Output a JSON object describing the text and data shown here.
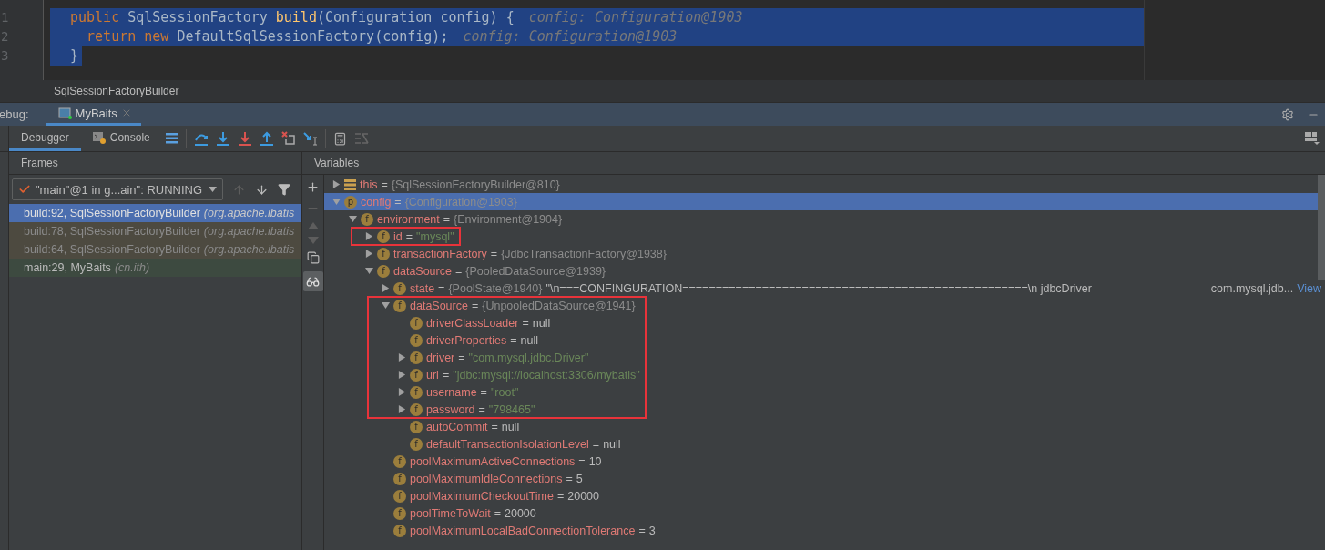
{
  "editor": {
    "line_numbers": [
      "1",
      "2",
      "3"
    ],
    "lines": [
      {
        "kind": "full",
        "selected": true,
        "tokens": [
          {
            "kind": "keyword",
            "text": "public"
          },
          {
            "kind": "plain",
            "text": " SqlSessionFactory "
          },
          {
            "kind": "method",
            "text": "build"
          },
          {
            "kind": "plain",
            "text": "(Configuration config) {"
          }
        ],
        "hint": "config: Configuration@1903"
      },
      {
        "kind": "full",
        "selected": true,
        "tokens": [
          {
            "kind": "keyword",
            "text": "  return new"
          },
          {
            "kind": "plain",
            "text": " DefaultSqlSessionFactory(config);"
          }
        ],
        "hint": "config: Configuration@1903"
      },
      {
        "kind": "partial",
        "selected": true,
        "tokens": [
          {
            "kind": "plain",
            "text": "}"
          }
        ]
      }
    ]
  },
  "breadcrumb": "SqlSessionFactoryBuilder",
  "debug_bar": {
    "label": "ebug:",
    "tabs": [
      {
        "label": "MyBaits",
        "selected": true
      }
    ]
  },
  "toolbar": {
    "tabs": [
      {
        "label": "Debugger",
        "selected": true,
        "kind": "plain"
      },
      {
        "label": "Console",
        "selected": false,
        "kind": "console"
      }
    ]
  },
  "frames": {
    "title": "Frames",
    "thread": "\"main\"@1 in g...ain\": RUNNING",
    "items": [
      {
        "method": "build:92, SqlSessionFactoryBuilder",
        "package": "(org.apache.ibatis",
        "kind": "library",
        "selected": true
      },
      {
        "method": "build:78, SqlSessionFactoryBuilder",
        "package": "(org.apache.ibatis",
        "kind": "library",
        "selected": false
      },
      {
        "method": "build:64, SqlSessionFactoryBuilder",
        "package": "(org.apache.ibatis",
        "kind": "library",
        "selected": false
      },
      {
        "method": "main:29, MyBaits",
        "package": "(cn.ith)",
        "kind": "project",
        "selected": false
      }
    ]
  },
  "variables": {
    "title": "Variables",
    "tree": [
      {
        "kind": "list",
        "name": "this",
        "equals": "=",
        "object_ref": "{SqlSessionFactoryBuilder@810}",
        "expanded": false,
        "selected": false,
        "highlight": false
      },
      {
        "kind": "member",
        "badge": "p",
        "name": "config",
        "equals": "=",
        "object_ref": "{Configuration@1903}",
        "expanded": true,
        "selected": true,
        "highlight": false,
        "children": [
          {
            "kind": "member",
            "badge": "f",
            "name": "environment",
            "equals": "=",
            "object_ref": "{Environment@1904}",
            "expanded": true,
            "selected": false,
            "highlight": false,
            "children": [
              {
                "kind": "member",
                "badge": "f",
                "name": "id",
                "equals": "=",
                "string_value": "\"mysql\"",
                "expanded": false,
                "selected": false,
                "highlight": true
              },
              {
                "kind": "member",
                "badge": "f",
                "name": "transactionFactory",
                "equals": "=",
                "object_ref": "{JdbcTransactionFactory@1938}",
                "expanded": false,
                "selected": false,
                "highlight": false
              },
              {
                "kind": "member",
                "badge": "f",
                "name": "dataSource",
                "equals": "=",
                "object_ref": "{PooledDataSource@1939}",
                "expanded": true,
                "selected": false,
                "highlight": false,
                "children": [
                  {
                    "kind": "member",
                    "badge": "f",
                    "name": "state",
                    "equals": "=",
                    "object_ref": "{PoolState@1940}",
                    "preview": "\"\\n===CONFINGURATION====================================================\\n jdbcDriver",
                    "preview_tail": "com.mysql.jdb...",
                    "link": "View",
                    "expanded": false,
                    "selected": false,
                    "highlight": false
                  },
                  {
                    "kind": "member",
                    "badge": "f",
                    "name": "dataSource",
                    "equals": "=",
                    "object_ref": "{UnpooledDataSource@1941}",
                    "expanded": true,
                    "selected": false,
                    "highlight": true,
                    "children": [
                      {
                        "kind": "member",
                        "badge": "f",
                        "name": "driverClassLoader",
                        "equals": "=",
                        "value": "null",
                        "selected": false,
                        "highlight": true
                      },
                      {
                        "kind": "member",
                        "badge": "f",
                        "name": "driverProperties",
                        "equals": "=",
                        "value": "null",
                        "selected": false,
                        "highlight": true
                      },
                      {
                        "kind": "member",
                        "badge": "f",
                        "name": "driver",
                        "equals": "=",
                        "string_value": "\"com.mysql.jdbc.Driver\"",
                        "expanded": false,
                        "selected": false,
                        "highlight": true
                      },
                      {
                        "kind": "member",
                        "badge": "f",
                        "name": "url",
                        "equals": "=",
                        "string_value": "\"jdbc:mysql://localhost:3306/mybatis\"",
                        "expanded": false,
                        "selected": false,
                        "highlight": true
                      },
                      {
                        "kind": "member",
                        "badge": "f",
                        "name": "username",
                        "equals": "=",
                        "string_value": "\"root\"",
                        "expanded": false,
                        "selected": false,
                        "highlight": true
                      },
                      {
                        "kind": "member",
                        "badge": "f",
                        "name": "password",
                        "equals": "=",
                        "string_value": "\"798465\"",
                        "expanded": false,
                        "selected": false,
                        "highlight": true
                      },
                      {
                        "kind": "member",
                        "badge": "f",
                        "name": "autoCommit",
                        "equals": "=",
                        "value": "null",
                        "selected": false,
                        "highlight": false
                      },
                      {
                        "kind": "member",
                        "badge": "f",
                        "name": "defaultTransactionIsolationLevel",
                        "equals": "=",
                        "value": "null",
                        "selected": false,
                        "highlight": false
                      }
                    ]
                  },
                  {
                    "kind": "member",
                    "badge": "f",
                    "name": "poolMaximumActiveConnections",
                    "equals": "=",
                    "value": "10",
                    "selected": false,
                    "highlight": false
                  },
                  {
                    "kind": "member",
                    "badge": "f",
                    "name": "poolMaximumIdleConnections",
                    "equals": "=",
                    "value": "5",
                    "selected": false,
                    "highlight": false
                  },
                  {
                    "kind": "member",
                    "badge": "f",
                    "name": "poolMaximumCheckoutTime",
                    "equals": "=",
                    "value": "20000",
                    "selected": false,
                    "highlight": false
                  },
                  {
                    "kind": "member",
                    "badge": "f",
                    "name": "poolTimeToWait",
                    "equals": "=",
                    "value": "20000",
                    "selected": false,
                    "highlight": false
                  },
                  {
                    "kind": "member",
                    "badge": "f",
                    "name": "poolMaximumLocalBadConnectionTolerance",
                    "equals": "=",
                    "value": "3",
                    "selected": false,
                    "highlight": false
                  }
                ]
              }
            ]
          }
        ]
      }
    ]
  }
}
